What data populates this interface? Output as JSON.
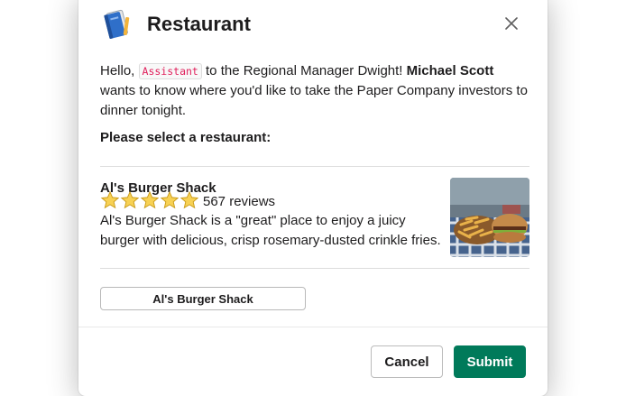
{
  "modal": {
    "title": "Restaurant",
    "app_icon": "blue-book-icon",
    "close_icon": "close-icon"
  },
  "message": {
    "greeting": "Hello, ",
    "mention": "Assistant",
    "after_mention": " to the Regional Manager Dwight! ",
    "bold_name": "Michael Scott",
    "rest": " wants to know where you'd like to take the Paper Company investors to dinner tonight.",
    "select_prompt": "Please select a restaurant:"
  },
  "restaurant": {
    "name": "Al's Burger Shack",
    "rating": 5,
    "rating_max": 5,
    "reviews": "567 reviews",
    "description": "Al's Burger Shack is a \"great\" place to enjoy a juicy burger with delicious, crisp rosemary-dusted crinkle fries.",
    "thumbnail": "burger-and-fries-image"
  },
  "select_button": {
    "label": "Al's Burger Shack"
  },
  "footer": {
    "cancel_label": "Cancel",
    "submit_label": "Submit"
  },
  "colors": {
    "submit_bg": "#007a5a",
    "mention_text": "#e01e5a",
    "star": "#f2c744"
  }
}
